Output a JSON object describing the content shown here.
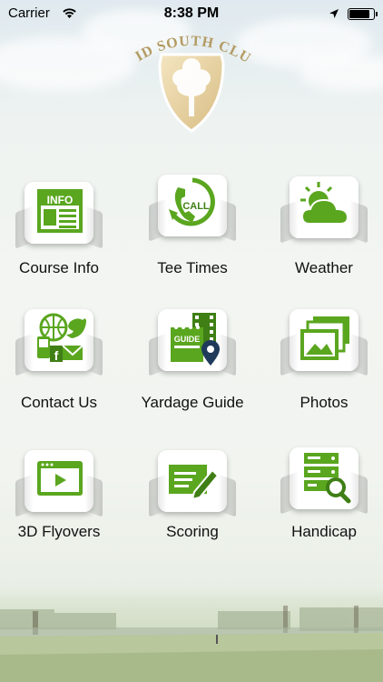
{
  "status": {
    "carrier": "Carrier",
    "time": "8:38 PM",
    "battery_level": 0.9
  },
  "logo": {
    "text": "MID SOUTH CLUB"
  },
  "menu": [
    {
      "label": "Course Info",
      "icon": "info-sheet-icon"
    },
    {
      "label": "Tee Times",
      "icon": "phone-call-icon"
    },
    {
      "label": "Weather",
      "icon": "sun-cloud-icon"
    },
    {
      "label": "Contact Us",
      "icon": "social-contact-icon"
    },
    {
      "label": "Yardage Guide",
      "icon": "guide-map-icon"
    },
    {
      "label": "Photos",
      "icon": "photos-icon"
    },
    {
      "label": "3D Flyovers",
      "icon": "video-player-icon"
    },
    {
      "label": "Scoring",
      "icon": "scorecard-pencil-icon"
    },
    {
      "label": "Handicap",
      "icon": "database-search-icon"
    }
  ],
  "colors": {
    "green": "#5aa61f",
    "dark_green": "#3f7f15"
  },
  "icon_text": {
    "info": "INFO",
    "call": "CALL",
    "guide": "GUIDE"
  }
}
